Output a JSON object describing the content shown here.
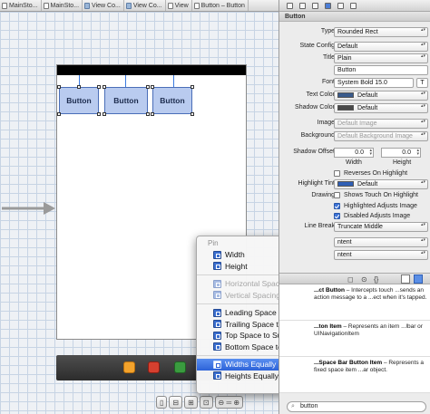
{
  "breadcrumbs": [
    "MainSto...",
    "MainSto...",
    "View Co...",
    "View Co...",
    "View",
    "Button – Button"
  ],
  "scene": {
    "buttons": [
      "Button",
      "Button",
      "Button"
    ]
  },
  "pin_menu": {
    "header": "Pin",
    "items": [
      {
        "label": "Width",
        "state": "enabled"
      },
      {
        "label": "Height",
        "state": "enabled"
      },
      {
        "label": "Horizontal Spacing",
        "state": "disabled"
      },
      {
        "label": "Vertical Spacing",
        "state": "disabled"
      },
      {
        "label": "Leading Space to Superview",
        "state": "enabled"
      },
      {
        "label": "Trailing Space to Superview",
        "state": "enabled"
      },
      {
        "label": "Top Space to Superview",
        "state": "enabled"
      },
      {
        "label": "Bottom Space to Superview",
        "state": "enabled"
      },
      {
        "label": "Widths Equally",
        "state": "selected"
      },
      {
        "label": "Heights Equally",
        "state": "enabled"
      }
    ]
  },
  "inspector": {
    "section_title": "Button",
    "type_label": "Type",
    "type_value": "Rounded Rect",
    "state_config_label": "State Config",
    "state_config_value": "Default",
    "title_label": "Title",
    "title_style_value": "Plain",
    "title_text_value": "Button",
    "font_label": "Font",
    "font_value": "System Bold 15.0",
    "text_color_label": "Text Color",
    "text_color_value": "Default",
    "shadow_color_label": "Shadow Color",
    "shadow_color_value": "Default",
    "image_label": "Image",
    "image_placeholder": "Default Image",
    "background_label": "Background",
    "background_placeholder": "Default Background Image",
    "shadow_offset_label": "Shadow Offset",
    "shadow_offset_width": "0.0",
    "shadow_offset_height": "0.0",
    "width_label": "Width",
    "height_label": "Height",
    "reverses_on_highlight": "Reverses On Highlight",
    "highlight_tint_label": "Highlight Tint",
    "highlight_tint_value": "Default",
    "drawing_label": "Drawing",
    "shows_touch": "Shows Touch On Highlight",
    "highlighted_adjusts": "Highlighted Adjusts Image",
    "disabled_adjusts": "Disabled Adjusts Image",
    "line_break_label": "Line Break",
    "line_break_value": "Truncate Middle",
    "partial_value_1": "ntent",
    "partial_value_2": "ntent"
  },
  "library": {
    "items": [
      {
        "title": "...ct Button",
        "desc": "– Intercepts touch ...sends an action message to a ...ect when it's tapped."
      },
      {
        "title": "...ton Item",
        "desc": "– Represents an item ...lbar or UINavigationItem"
      },
      {
        "title": "...Space Bar Button Item",
        "desc": "– Represents a fixed space item ...ar object."
      }
    ],
    "search_value": "button"
  },
  "colors": {
    "menu_selected": "#2c62d8",
    "button_fill": "#b9cbef",
    "text_color_swatch": "#3a5b8c",
    "shadow_color_swatch": "#4a4a4a",
    "highlight_tint_swatch": "#2f5fb5"
  }
}
